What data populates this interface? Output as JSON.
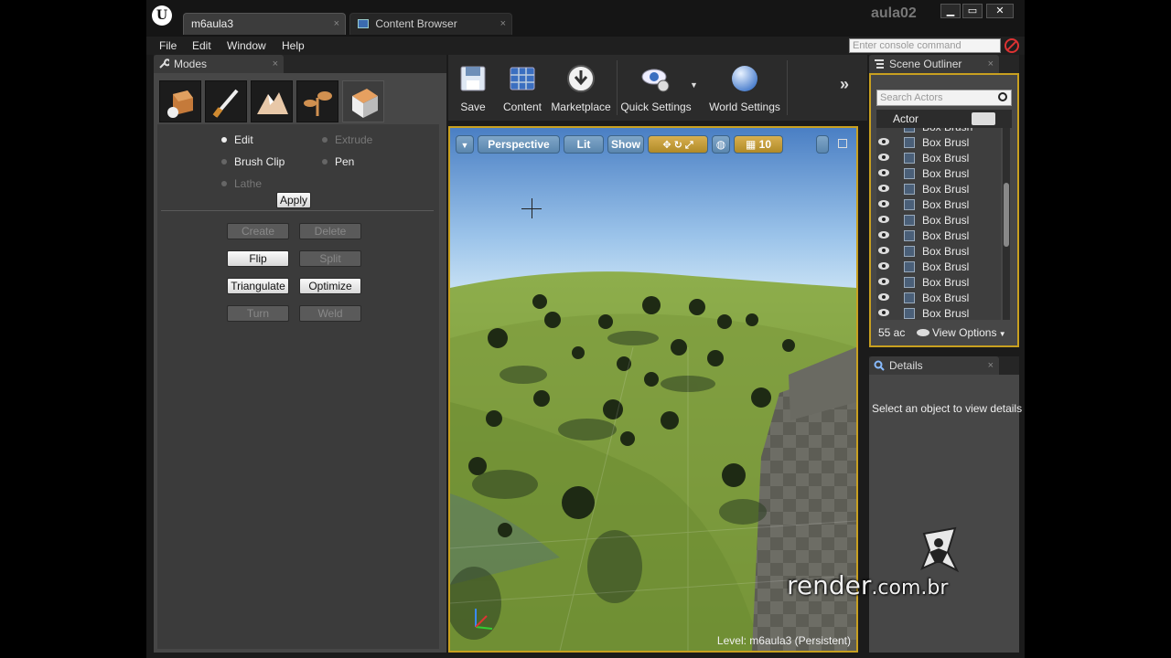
{
  "window": {
    "tabs": [
      {
        "label": "m6aula3"
      },
      {
        "label": "Content Browser"
      }
    ],
    "close_glyph": "×",
    "project_name": "aula02",
    "controls": {
      "minimize": "▁",
      "maximize": "▭",
      "close": "✕"
    }
  },
  "menu": {
    "items": [
      "File",
      "Edit",
      "Window",
      "Help"
    ],
    "console_placeholder": "Enter console command"
  },
  "modes_panel": {
    "title": "Modes",
    "mode_icons": [
      "place-mode-icon",
      "paint-mode-icon",
      "landscape-mode-icon",
      "foliage-mode-icon",
      "geometry-mode-icon"
    ],
    "tools": {
      "edit": "Edit",
      "extrude": "Extrude",
      "brush_clip": "Brush Clip",
      "pen": "Pen",
      "lathe": "Lathe",
      "apply": "Apply"
    },
    "actions": {
      "create": "Create",
      "delete": "Delete",
      "flip": "Flip",
      "split": "Split",
      "triangulate": "Triangulate",
      "optimize": "Optimize",
      "turn": "Turn",
      "weld": "Weld"
    }
  },
  "toolbar": {
    "save": "Save",
    "content": "Content",
    "marketplace": "Marketplace",
    "quick_settings": "Quick Settings",
    "world_settings": "World Settings",
    "more": "»"
  },
  "viewport": {
    "view_mode": "Perspective",
    "lighting": "Lit",
    "show": "Show",
    "grid_size": "10",
    "level_label": "Level:  m6aula3 (Persistent)"
  },
  "scene_outliner": {
    "title": "Scene Outliner",
    "search_placeholder": "Search Actors",
    "column_header": "Actor",
    "partial_top": "Box Brush",
    "rows": [
      "Box Brusl",
      "Box Brusl",
      "Box Brusl",
      "Box Brusl",
      "Box Brusl",
      "Box Brusl",
      "Box Brusl",
      "Box Brusl",
      "Box Brusl",
      "Box Brusl",
      "Box Brusl",
      "Box Brusl"
    ],
    "actor_count": "55 ac",
    "view_options": "View Options"
  },
  "details_panel": {
    "title": "Details",
    "empty_message": "Select an object to view details"
  },
  "watermark": {
    "text_main": "render",
    "text_suffix": ".com.br"
  },
  "colors": {
    "selection_outline": "#c8a020",
    "viewport_sky_top": "#4f86c6",
    "viewport_grass": "#7c9a3c"
  }
}
